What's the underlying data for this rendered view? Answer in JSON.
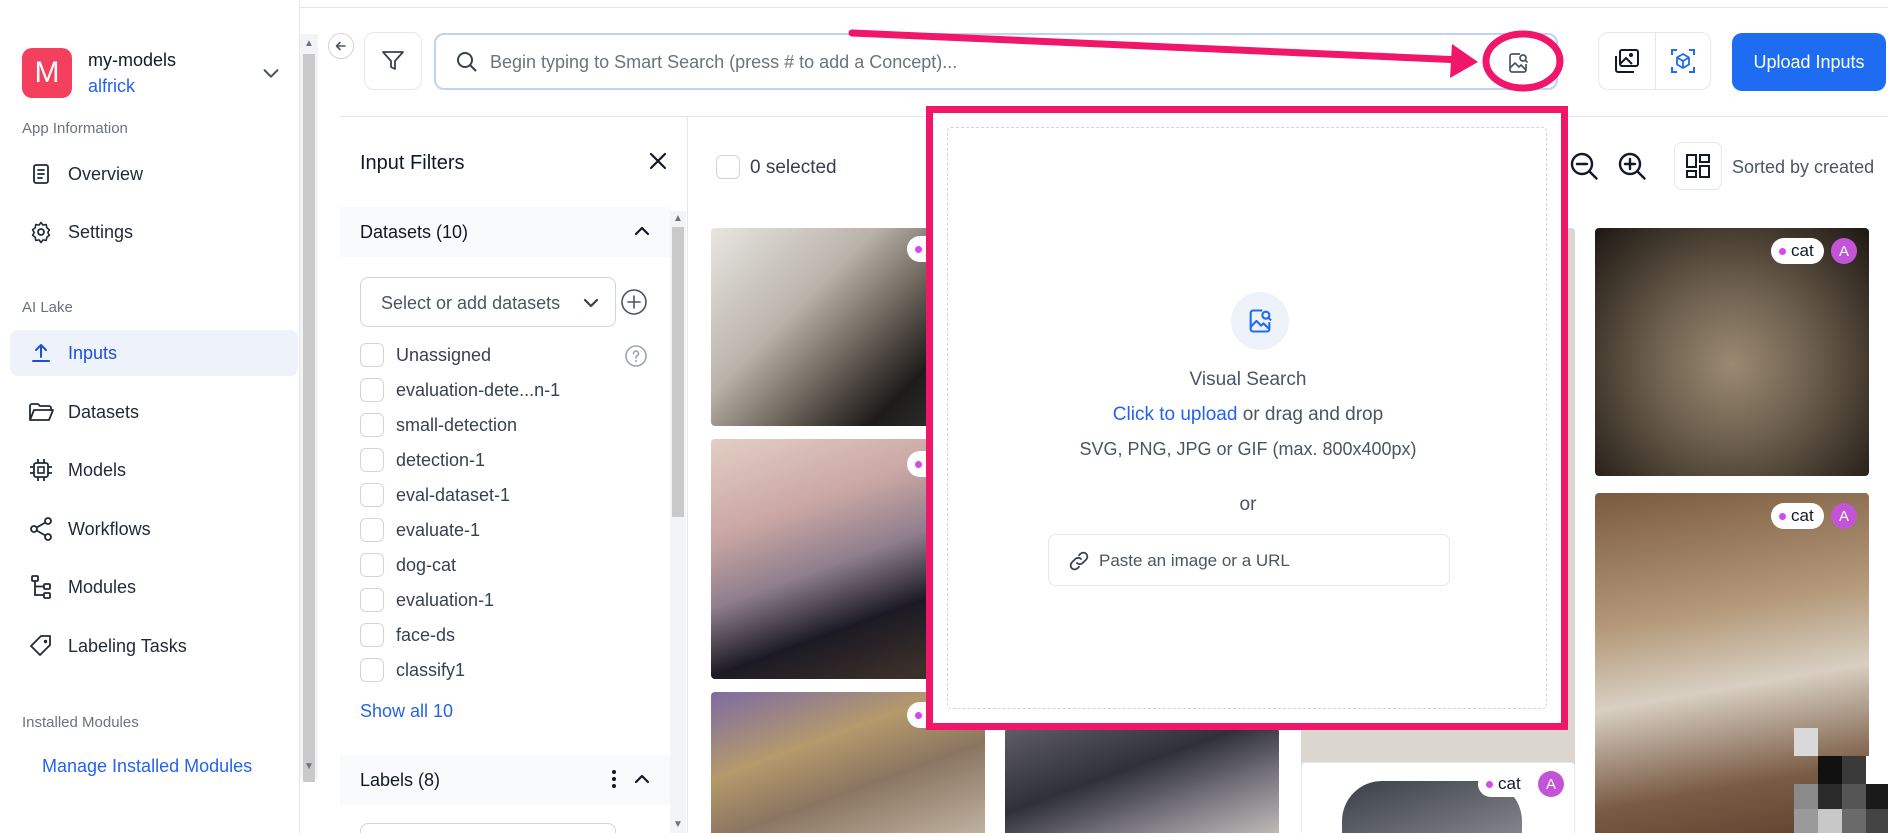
{
  "app": {
    "avatar_letter": "M",
    "name": "my-models",
    "user": "alfrick"
  },
  "nav": {
    "section_app_info": "App Information",
    "overview": "Overview",
    "settings": "Settings",
    "section_ai_lake": "AI Lake",
    "inputs": "Inputs",
    "datasets": "Datasets",
    "models": "Models",
    "workflows": "Workflows",
    "modules": "Modules",
    "labeling_tasks": "Labeling Tasks",
    "section_installed": "Installed Modules",
    "manage_installed": "Manage Installed Modules",
    "active_item": "Inputs"
  },
  "search": {
    "placeholder": "Begin typing to Smart Search (press # to add a Concept)..."
  },
  "toolbar": {
    "upload_label": "Upload Inputs"
  },
  "filters": {
    "title": "Input Filters",
    "datasets_header": "Datasets (10)",
    "select_placeholder": "Select or add datasets",
    "datasets": [
      "Unassigned",
      "evaluation-dete...n-1",
      "small-detection",
      "detection-1",
      "eval-dataset-1",
      "evaluate-1",
      "dog-cat",
      "evaluation-1",
      "face-ds",
      "classify1"
    ],
    "show_all": "Show all 10",
    "labels_header": "Labels (8)"
  },
  "gallery": {
    "selected_text": "0 selected",
    "sort_text": "Sorted by created",
    "tag_label": "cat",
    "tag_avatar": "A"
  },
  "visual_search": {
    "title": "Visual Search",
    "upload_link": "Click to upload",
    "drag_text": " or drag and drop",
    "formats": "SVG, PNG, JPG or GIF (max. 800x400px)",
    "or": "or",
    "paste_placeholder": "Paste an image or a URL"
  },
  "colors": {
    "accent": "#1d6cf2",
    "annotation": "#f0166a",
    "avatar": "#f43f5e",
    "tag_dot": "#d946ef"
  }
}
